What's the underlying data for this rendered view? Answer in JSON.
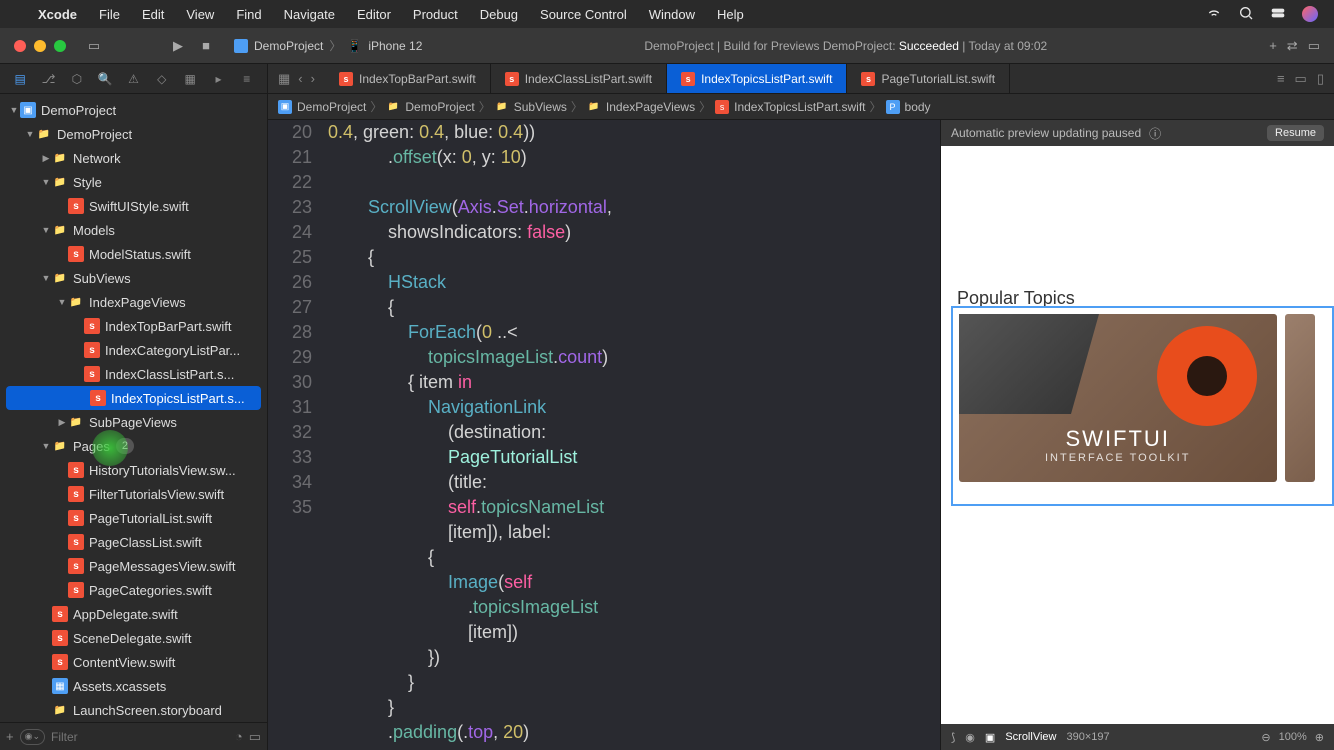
{
  "menubar": {
    "app": "Xcode",
    "items": [
      "File",
      "Edit",
      "View",
      "Find",
      "Navigate",
      "Editor",
      "Product",
      "Debug",
      "Source Control",
      "Window",
      "Help"
    ]
  },
  "toolbar": {
    "scheme_project": "DemoProject",
    "scheme_device": "iPhone 12",
    "status_prefix": "DemoProject | Build for Previews DemoProject: ",
    "status_result": "Succeeded",
    "status_time": "Today at 09:02"
  },
  "navigator": {
    "root": "DemoProject",
    "tree": [
      {
        "d": 0,
        "open": true,
        "ic": "proj",
        "l": "DemoProject"
      },
      {
        "d": 1,
        "open": true,
        "ic": "fold",
        "l": "DemoProject"
      },
      {
        "d": 2,
        "open": false,
        "ic": "fold",
        "l": "Network"
      },
      {
        "d": 2,
        "open": true,
        "ic": "fold",
        "l": "Style"
      },
      {
        "d": 3,
        "ic": "swift",
        "l": "SwiftUIStyle.swift"
      },
      {
        "d": 2,
        "open": true,
        "ic": "fold",
        "l": "Models"
      },
      {
        "d": 3,
        "ic": "swift",
        "l": "ModelStatus.swift"
      },
      {
        "d": 2,
        "open": true,
        "ic": "fold",
        "l": "SubViews"
      },
      {
        "d": 3,
        "open": true,
        "ic": "fold",
        "l": "IndexPageViews"
      },
      {
        "d": 4,
        "ic": "swift",
        "l": "IndexTopBarPart.swift"
      },
      {
        "d": 4,
        "ic": "swift",
        "l": "IndexCategoryListPar..."
      },
      {
        "d": 4,
        "ic": "swift",
        "l": "IndexClassListPart.s..."
      },
      {
        "d": 4,
        "ic": "swift",
        "l": "IndexTopicsListPart.s...",
        "sel": true
      },
      {
        "d": 3,
        "open": false,
        "ic": "fold",
        "l": "SubPageViews"
      },
      {
        "d": 2,
        "open": true,
        "ic": "fold",
        "l": "Pages",
        "badge": "2"
      },
      {
        "d": 3,
        "ic": "swift",
        "l": "HistoryTutorialsView.sw..."
      },
      {
        "d": 3,
        "ic": "swift",
        "l": "FilterTutorialsView.swift"
      },
      {
        "d": 3,
        "ic": "swift",
        "l": "PageTutorialList.swift"
      },
      {
        "d": 3,
        "ic": "swift",
        "l": "PageClassList.swift"
      },
      {
        "d": 3,
        "ic": "swift",
        "l": "PageMessagesView.swift"
      },
      {
        "d": 3,
        "ic": "swift",
        "l": "PageCategories.swift"
      },
      {
        "d": 2,
        "ic": "swift",
        "l": "AppDelegate.swift"
      },
      {
        "d": 2,
        "ic": "swift",
        "l": "SceneDelegate.swift"
      },
      {
        "d": 2,
        "ic": "swift",
        "l": "ContentView.swift"
      },
      {
        "d": 2,
        "ic": "assets",
        "l": "Assets.xcassets"
      },
      {
        "d": 2,
        "ic": "fold",
        "l": "LaunchScreen.storyboard"
      }
    ],
    "filter_placeholder": "Filter"
  },
  "editor": {
    "tabs": [
      {
        "l": "IndexTopBarPart.swift"
      },
      {
        "l": "IndexClassListPart.swift"
      },
      {
        "l": "IndexTopicsListPart.swift",
        "on": true
      },
      {
        "l": "PageTutorialList.swift"
      }
    ],
    "breadcrumb": [
      "DemoProject",
      "DemoProject",
      "SubViews",
      "IndexPageViews",
      "IndexTopicsListPart.swift",
      "body"
    ],
    "lines": [
      20,
      21,
      22,
      23,
      24,
      25,
      26,
      27,
      28,
      29,
      30,
      31,
      32,
      33,
      34,
      35
    ]
  },
  "preview": {
    "banner": "Automatic preview updating paused",
    "resume": "Resume",
    "topics_title": "Popular Topics",
    "card1_t1": "SWIFTUI",
    "card1_t2": "INTERFACE TOOLKIT",
    "footer_sel": "ScrollView",
    "footer_dim": "390×197",
    "footer_zoom": "100%"
  }
}
